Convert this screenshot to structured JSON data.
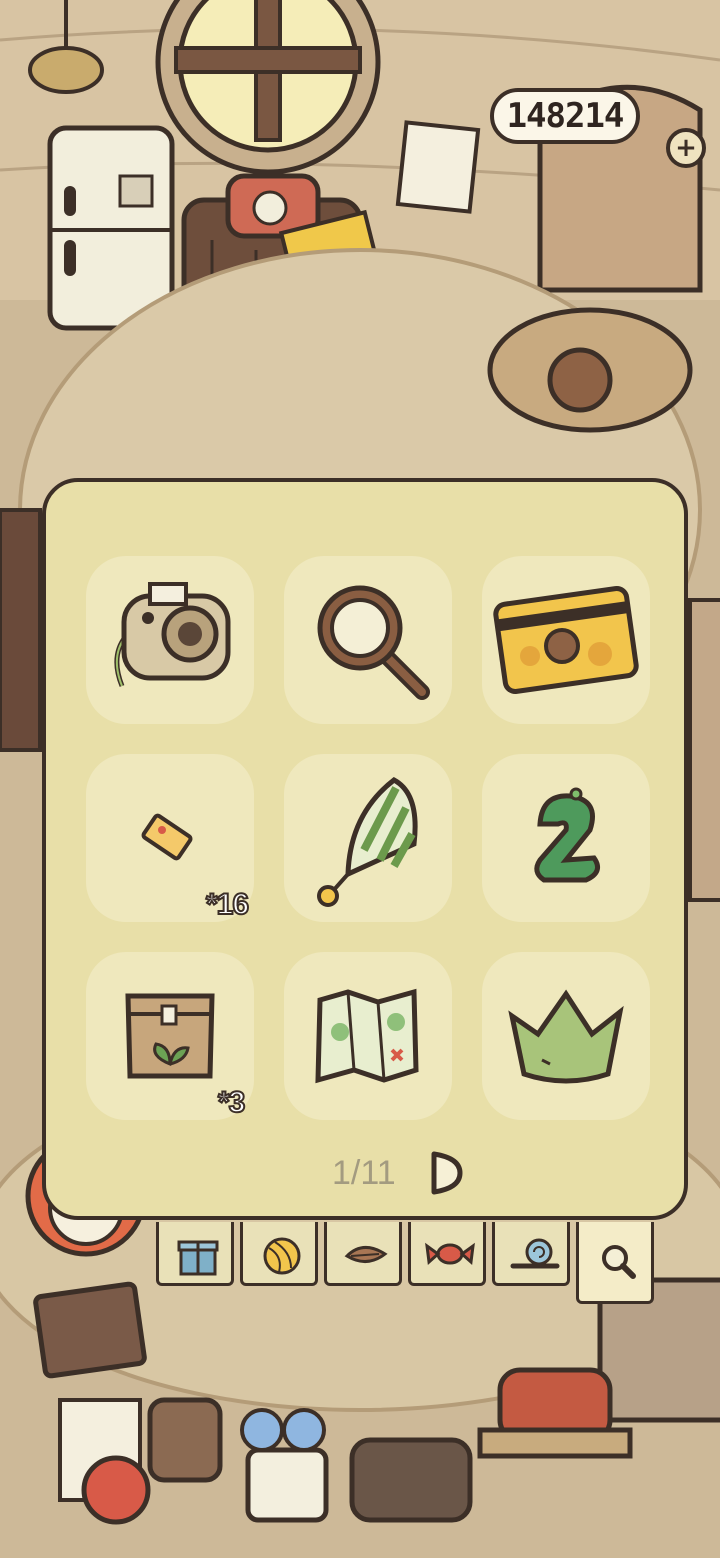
{
  "currency": {
    "amount": "148214",
    "add_label": "+"
  },
  "inventory": {
    "items": [
      {
        "name": "instant-camera",
        "count": ""
      },
      {
        "name": "magnifying-glass",
        "count": ""
      },
      {
        "name": "acorn-card",
        "count": ""
      },
      {
        "name": "ticket",
        "count": "*16"
      },
      {
        "name": "striped-balloon",
        "count": ""
      },
      {
        "name": "green-number-2-balloon",
        "count": ""
      },
      {
        "name": "seed-bag",
        "count": "*3"
      },
      {
        "name": "folded-map",
        "count": ""
      },
      {
        "name": "green-crown",
        "count": ""
      }
    ],
    "page_indicator": "1/11"
  },
  "tabs": [
    {
      "icon": "gift-icon"
    },
    {
      "icon": "yarn-ball-icon"
    },
    {
      "icon": "leaf-icon"
    },
    {
      "icon": "candy-icon"
    },
    {
      "icon": "snail-icon"
    },
    {
      "icon": "magnifier-icon",
      "active": true
    }
  ],
  "colors": {
    "panel": "#e8dfa8",
    "slot": "#efe8bd",
    "outline": "#3c2f27"
  }
}
